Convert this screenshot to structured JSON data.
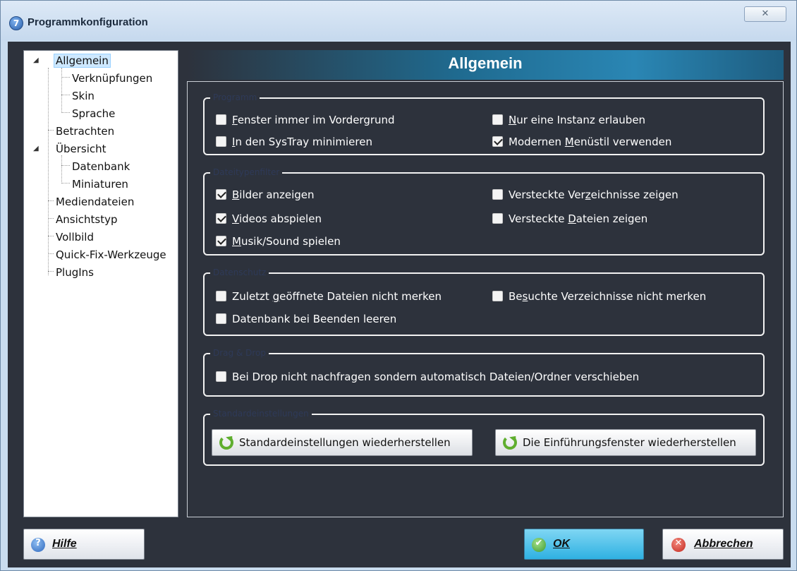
{
  "window": {
    "title": "Programmkonfiguration",
    "app_icon_glyph": "7",
    "close_glyph": "✕"
  },
  "tree": {
    "items": [
      {
        "label": "Allgemein",
        "selected": true,
        "expanded": true
      },
      {
        "label": "Verknüpfungen"
      },
      {
        "label": "Skin"
      },
      {
        "label": "Sprache"
      },
      {
        "label": "Betrachten"
      },
      {
        "label": "Übersicht",
        "expanded": true
      },
      {
        "label": "Datenbank"
      },
      {
        "label": "Miniaturen"
      },
      {
        "label": "Mediendateien"
      },
      {
        "label": "Ansichtstyp"
      },
      {
        "label": "Vollbild"
      },
      {
        "label": "Quick-Fix-Werkzeuge"
      },
      {
        "label": "PlugIns"
      }
    ],
    "expander_glyph": "◢"
  },
  "header": {
    "title": "Allgemein"
  },
  "groups": {
    "programm": {
      "legend": "Programm",
      "fenster": {
        "pre": "",
        "u": "F",
        "post": "enster immer im Vordergrund",
        "checked": false
      },
      "systray": {
        "pre": "",
        "u": "I",
        "post": "n den SysTray minimieren",
        "checked": false
      },
      "instanz": {
        "pre": "",
        "u": "N",
        "post": "ur eine Instanz erlauben",
        "checked": false
      },
      "menustil": {
        "pre": "Modernen ",
        "u": "M",
        "post": "enüstil verwenden",
        "checked": true
      }
    },
    "dateitypen": {
      "legend": "Dateitypenfilter",
      "bilder": {
        "pre": "",
        "u": "B",
        "post": "ilder anzeigen",
        "checked": true
      },
      "videos": {
        "pre": "",
        "u": "V",
        "post": "ideos abspielen",
        "checked": true
      },
      "musik": {
        "pre": "",
        "u": "M",
        "post": "usik/Sound spielen",
        "checked": true
      },
      "verz": {
        "pre": "Versteckte Ver",
        "u": "z",
        "post": "eichnisse zeigen",
        "checked": false
      },
      "dateien": {
        "pre": "Versteckte ",
        "u": "D",
        "post": "ateien zeigen",
        "checked": false
      }
    },
    "datenschutz": {
      "legend": "Datenschutz",
      "zuletzt": {
        "pre": "Zuletzt ",
        "u": "g",
        "post": "eöffnete Dateien nicht merken",
        "checked": false
      },
      "datenbank": {
        "pre": "Datenbank bei Beenden leeren",
        "u": "",
        "post": "",
        "checked": false
      },
      "besuchte": {
        "pre": "Be",
        "u": "s",
        "post": "uchte Verzeichnisse nicht merken",
        "checked": false
      }
    },
    "dragdrop": {
      "legend": "Drag & Drop",
      "drop": {
        "pre": "Bei Drop nicht nachfragen sondern automatisch Dateien/Ordner verschieben",
        "u": "",
        "post": "",
        "checked": false
      }
    },
    "standard": {
      "legend": "Standardeinstellungen",
      "restore_defaults": "Standardeinstellungen wiederherstellen",
      "restore_intro": "Die Einführungsfenster wiederherstellen"
    }
  },
  "footer": {
    "help": "Hilfe",
    "ok": "OK",
    "cancel": "Abbrechen",
    "help_glyph": "?",
    "ok_glyph": "✔",
    "cancel_glyph": "✕"
  }
}
